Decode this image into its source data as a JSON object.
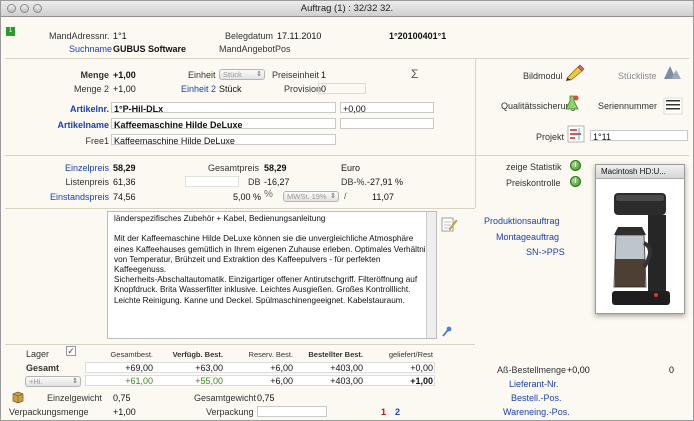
{
  "window": {
    "title": "Auftrag (1) : 32/32 32."
  },
  "header": {
    "mandadressnr_label": "MandAdressnr.",
    "mandadressnr_value": "1°1",
    "belegdatum_label": "Belegdatum",
    "belegdatum_value": "17.11.2010",
    "belegnr_value": "1°20100401°1",
    "suchname_label": "Suchname",
    "suchname_value": "GUBUS Software",
    "mandangebotpos_label": "MandAngebotPos"
  },
  "article": {
    "menge_label": "Menge",
    "menge_value": "+1,00",
    "einheit_label": "Einheit",
    "einheit_select": "Stück",
    "preiseinheit_label": "Preiseinheit",
    "preiseinheit_value": "1",
    "menge2_label": "Menge 2",
    "menge2_value": "+1,00",
    "einheit2_label": "Einheit 2",
    "einheit2_value": "Stück",
    "provision_label": "Provision",
    "provision_value": "0",
    "artikelnr_label": "Artikelnr.",
    "artikelnr_value": "1°P-Hil-DLx",
    "artikelnr_extra": "+0,00",
    "artikelname_label": "Artikelname",
    "artikelname_value": "Kaffeemaschine Hilde DeLuxe",
    "frei1_label": "Free1",
    "frei1_value": "Kaffeemaschine Hilde DeLuxe"
  },
  "right_top": {
    "bildmodul_label": "Bildmodul",
    "stueckliste_label": "Stückliste",
    "qualitaet_label": "Qualitätssicherung",
    "seriennummer_label": "Seriennummer",
    "projekt_label": "Projekt",
    "projekt_value": "1°11"
  },
  "prices": {
    "einzelpreis_label": "Einzelpreis",
    "einzelpreis_value": "58,29",
    "gesamtpreis_label": "Gesamtpreis",
    "gesamtpreis_value": "58,29",
    "currency": "Euro",
    "listenpreis_label": "Listenpreis",
    "listenpreis_value": "61,36",
    "db_label": "DB",
    "db_value": "-16,27",
    "dbpct_label": "DB-%.",
    "dbpct_value": "-27,91 %",
    "einstandspreis_label": "Einstandspreis",
    "einstandspreis_value": "74,56",
    "rabatt_value": "5,00 %",
    "mwst_select": "MWSt. 19%",
    "mwst_value": "11,07"
  },
  "statistics": {
    "zeige_statistik_label": "zeige Statistik",
    "preiskontrolle_label": "Preiskontrolle",
    "popup_title": "Macintosh HD:U..."
  },
  "description": {
    "text": "länderspezifisches Zubehör + Kabel, Bedienungsanleitung\n\nMit der Kaffeemaschine Hilde DeLuxe können sie die unvergleichliche Atmosphäre eines Kaffeehauses gemütlich in Ihrem eigenen Zuhause erleben. Optimales Verhältnis von Temperatur, Brühzeit und Extraktion des Kaffeepulvers - für perfekten Kaffeegenuss.\nSicherheits-Abschaltautomatik. Einzigartiger offener Antirutschgriff. Filteröffnung auf Knopfdruck. Brita Wasserfilter inklusive. Leichtes Ausgießen. Großes Kontrolllicht. Leichte Reinigung. Kanne und Deckel. Spülmaschinengeeignet. Kabelstauraum."
  },
  "links": {
    "produktionsauftrag": "Produktionsauftrag",
    "montageauftrag": "Montageauftrag",
    "sn_pps": "SN->PPS"
  },
  "stock": {
    "lager_label": "Lager",
    "headers": [
      "Gesamtbest.",
      "Verfügb. Best.",
      "Reserv. Best.",
      "Bestellter Best.",
      "geliefert/Rest"
    ],
    "row1_label": "Gesamt",
    "row1": [
      "+69,00",
      "+63,00",
      "+6,00",
      "+403,00",
      "+0,00"
    ],
    "row2_select": "+Hi.",
    "row2": [
      "+61,00",
      "+55,00",
      "+6,00",
      "+403,00",
      "+1,00"
    ]
  },
  "bottom": {
    "einzelgewicht_label": "Einzelgewicht",
    "einzelgewicht_value": "0,75",
    "gesamtgewicht_label": "Gesamtgewicht",
    "gesamtgewicht_value": "0,75",
    "verpackungsmenge_label": "Verpackungsmenge",
    "verpackungsmenge_value": "+1,00",
    "verpackung_label": "Verpackung",
    "page1": "1",
    "page2": "2",
    "ab_bestellmenge_label": "Aß-Bestellmenge",
    "ab_bestellmenge_value": "+0,00",
    "ab_bestellmenge_extra": "0",
    "lieferant_nr": "Lieferant-Nr.",
    "bestell_pos": "Bestell.-Pos.",
    "wareneing_pos": "Wareneing.-Pos."
  },
  "colors": {
    "link": "#1b3fb5",
    "green": "#3a8a1e",
    "red": "#d01010",
    "window_bg": "#fbf9f1"
  }
}
